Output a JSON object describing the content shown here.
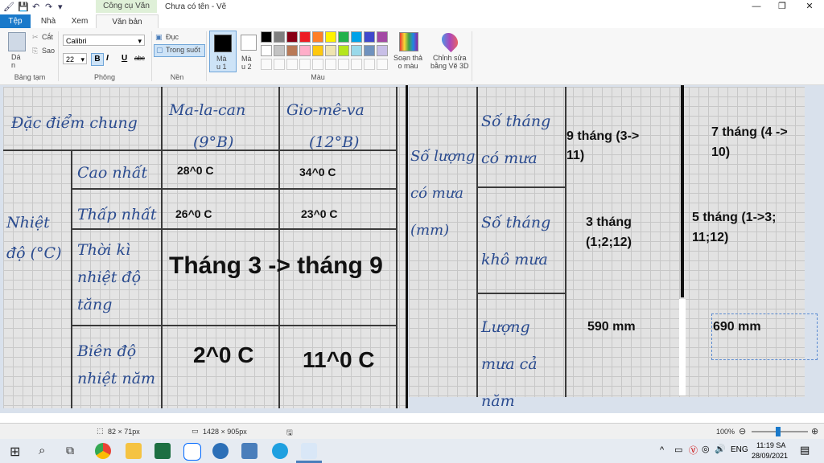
{
  "titlebar": {
    "context_tab": "Công cụ Văn bản",
    "document_title": "Chưa có tên - Vẽ",
    "minimize": "—",
    "maximize": "❐",
    "close": "✕"
  },
  "tabs": {
    "file": "Tệp",
    "home": "Nhà",
    "view": "Xem",
    "text": "Văn bản"
  },
  "ribbon": {
    "clipboard": {
      "paste": "Dá\nn",
      "cut": "Cắt",
      "copy": "Sao",
      "label": "Bảng tạm"
    },
    "font": {
      "family": "Calibri",
      "size": "22",
      "bold": "B",
      "italic": "I",
      "underline": "U",
      "strike": "abc",
      "label": "Phông"
    },
    "background": {
      "opaque": "Đục",
      "transparent": "Trong suốt",
      "label": "Nền"
    },
    "colors": {
      "color1": "Mà\nu 1",
      "color2": "Mà\nu 2",
      "edit_colors": "Soạn thả\no màu",
      "edit_3d": "Chỉnh sửa\nbằng Vẽ 3D",
      "label": "Màu",
      "palette_row1": [
        "#000000",
        "#7f7f7f",
        "#880015",
        "#ed1c24",
        "#ff7f27",
        "#fff200",
        "#22b14c",
        "#00a2e8",
        "#3f48cc",
        "#a349a4"
      ],
      "palette_row2": [
        "#ffffff",
        "#c3c3c3",
        "#b97a57",
        "#ffaec9",
        "#ffc90e",
        "#efe4b0",
        "#b5e61d",
        "#99d9ea",
        "#7092be",
        "#c8bfe7"
      ],
      "primary": "#000000",
      "secondary": "#ffffff"
    }
  },
  "left_image": {
    "headers": [
      "Đặc điểm chung",
      "Ma-la-can",
      "(9°B)",
      "Gio-mê-va",
      "(12°B)"
    ],
    "row_group": "Nhiệt độ (°C)",
    "row_labels": [
      "Cao nhất",
      "Thấp nhất",
      "Thời kì nhiệt độ tăng",
      "Biên độ nhiệt năm"
    ],
    "typed": {
      "high_a": "28^0 C",
      "high_b": "34^0 C",
      "low_a": "26^0 C",
      "low_b": "23^0 C",
      "rise_period": "Tháng 3 -> tháng 9",
      "range_a": "2^0 C",
      "range_b": "11^0 C"
    }
  },
  "right_image": {
    "group_label": "Số lượng có mưa (mm)",
    "row_labels": [
      "Số tháng có mưa",
      "Số tháng khô mưa",
      "Lượng mưa cả năm"
    ],
    "typed": {
      "rain_months_a": "9 tháng (3->\n11)",
      "rain_months_b": "7 tháng (4 ->\n10)",
      "dry_months_a": "3 tháng\n(1;2;12)",
      "dry_months_b": "5 tháng (1->3;\n11;12)",
      "total_a": "590 mm",
      "total_b": "690 mm"
    }
  },
  "statusbar": {
    "selection_size": "82 × 71px",
    "image_size": "1428 × 905px",
    "zoom": "100%"
  },
  "taskbar": {
    "language": "ENG",
    "time": "11:19 SA",
    "date": "28/09/2021"
  }
}
